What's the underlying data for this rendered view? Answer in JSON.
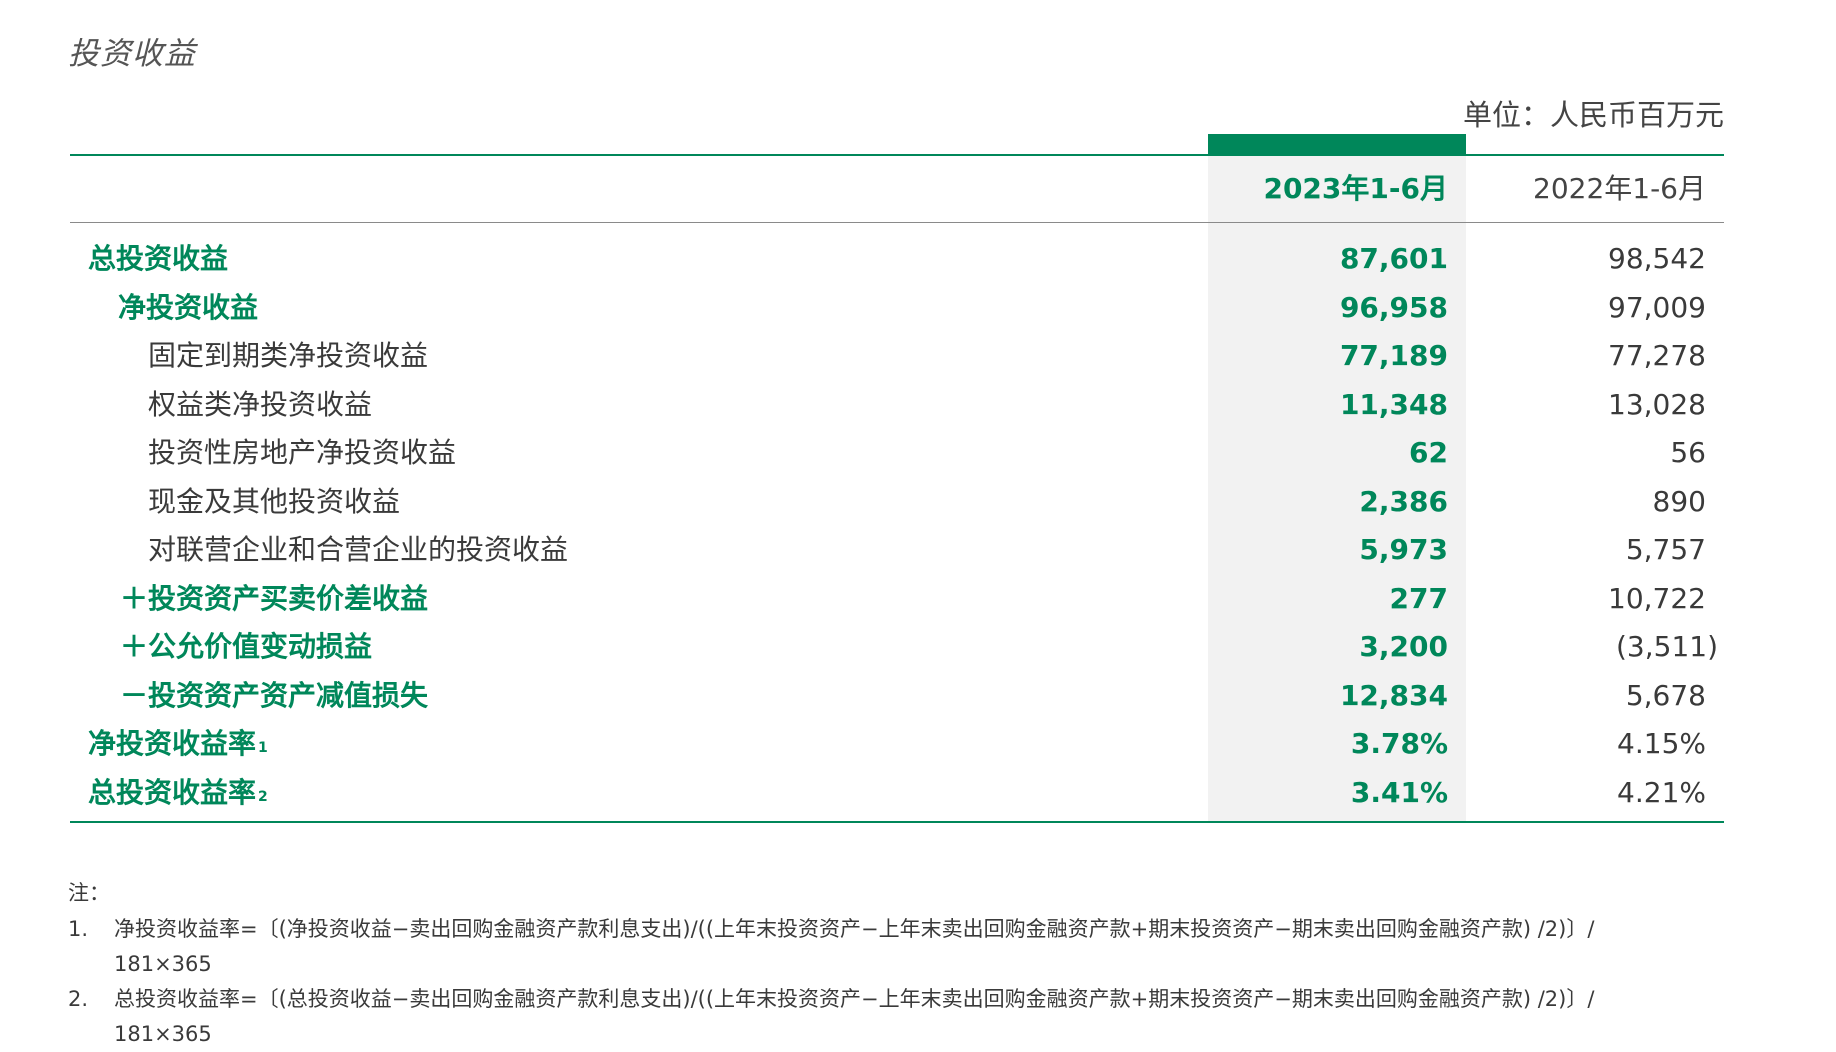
{
  "title": "投资收益",
  "unit": "单位：人民币百万元",
  "header": {
    "current": "2023年1-6月",
    "previous": "2022年1-6月"
  },
  "rows": [
    {
      "label": "总投资收益",
      "current": "87,601",
      "previous": "98,542"
    },
    {
      "label": "净投资收益",
      "current": "96,958",
      "previous": "97,009"
    },
    {
      "label": "固定到期类净投资收益",
      "current": "77,189",
      "previous": "77,278"
    },
    {
      "label": "权益类净投资收益",
      "current": "11,348",
      "previous": "13,028"
    },
    {
      "label": "投资性房地产净投资收益",
      "current": "62",
      "previous": "56"
    },
    {
      "label": "现金及其他投资收益",
      "current": "2,386",
      "previous": "890"
    },
    {
      "label": "对联营企业和合营企业的投资收益",
      "current": "5,973",
      "previous": "5,757"
    },
    {
      "label": "＋投资资产买卖价差收益",
      "current": "277",
      "previous": "10,722"
    },
    {
      "label": "＋公允价值变动损益",
      "current": "3,200",
      "previous": "(3,511)"
    },
    {
      "label": "－投资资产资产减值损失",
      "current": "12,834",
      "previous": "5,678"
    },
    {
      "label": "净投资收益率",
      "sup": "1",
      "current": "3.78%",
      "previous": "4.15%"
    },
    {
      "label": "总投资收益率",
      "sup": "2",
      "current": "3.41%",
      "previous": "4.21%"
    }
  ],
  "notes": {
    "heading": "注：",
    "items": [
      {
        "num": "1.",
        "line1": "净投资收益率=〔(净投资收益−卖出回购金融资产款利息支出)/((上年末投资资产−上年末卖出回购金融资产款+期末投资资产−期末卖出回购金融资产款) /2)〕/",
        "line2": "181×365"
      },
      {
        "num": "2.",
        "line1": "总投资收益率=〔(总投资收益−卖出回购金融资产款利息支出)/((上年末投资资产−上年末卖出回购金融资产款+期末投资资产−期末卖出回购金融资产款) /2)〕/",
        "line2": "181×365"
      }
    ]
  },
  "colors": {
    "accent": "#00875a",
    "shade": "#f2f2f2",
    "text": "#3a3a3a"
  }
}
